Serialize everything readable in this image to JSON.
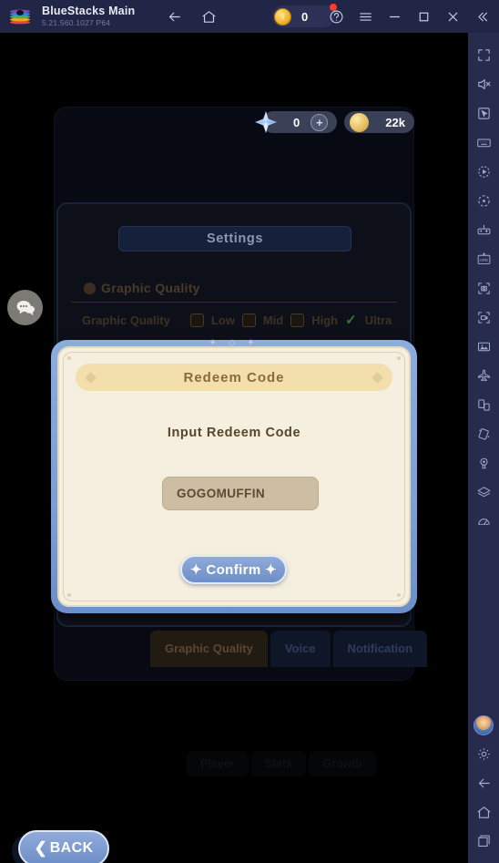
{
  "titlebar": {
    "app_name": "BlueStacks Main",
    "version": "5.21.560.1027  P64",
    "coin_count": "0",
    "icons": [
      "back-arrow-icon",
      "home-icon",
      "coin-icon",
      "help-icon",
      "menu-icon",
      "minimize-icon",
      "maximize-icon",
      "close-icon",
      "collapse-icon"
    ]
  },
  "hud": {
    "gem_value": "0",
    "plus_label": "+",
    "coin_value": "22k"
  },
  "background_settings": {
    "panel_title": "Settings",
    "section_header": "Graphic Quality",
    "row_label": "Graphic Quality",
    "options": [
      "Low",
      "Mid",
      "High",
      "Ultra"
    ],
    "selected_option": "Ultra",
    "check_glyph": "✓",
    "tabs": [
      "Graphic Quality",
      "Voice",
      "Notification"
    ],
    "active_tab": "Graphic Quality",
    "lower_tabs": [
      "Player",
      "Stats",
      "Growth"
    ]
  },
  "modal": {
    "title": "Redeem  Code",
    "prompt": "Input  Redeem  Code",
    "code_value": "GOGOMUFFIN",
    "code_placeholder": "Input Redeem Code",
    "confirm_label": "Confirm",
    "sparkle": "✦ ◇ ✦",
    "spark_glyph": "✦",
    "frame_color": "#7b9fd6",
    "panel_color": "#f5efdf",
    "title_bar_color": "#f3dfae"
  },
  "back_button": {
    "label": "BACK",
    "chevron": "❮"
  },
  "sidebar": {
    "items": [
      "fullscreen-icon",
      "mute-icon",
      "cursor-icon",
      "keyboard-icon",
      "macro-record-icon",
      "rotate-icon",
      "gamepad-icon",
      "apk-install-icon",
      "screenshot-icon",
      "video-record-icon",
      "media-manager-icon",
      "airplane-icon",
      "multi-instance-icon",
      "tilt-icon",
      "location-icon",
      "layers-icon",
      "speedometer-icon"
    ],
    "bottom_items": [
      "avatar",
      "gear-icon",
      "back-nav-icon",
      "home-nav-icon",
      "recents-nav-icon"
    ]
  },
  "chat": {
    "icon": "chat-bubble-icon"
  }
}
